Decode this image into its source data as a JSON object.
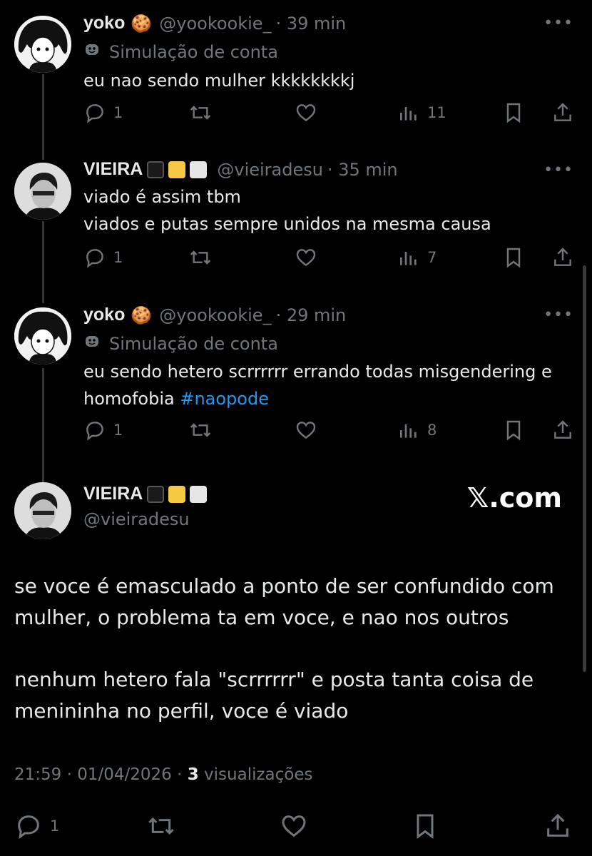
{
  "tweets": [
    {
      "name": "yoko",
      "name_emoji": "🍪",
      "handle": "@yookookie_",
      "time": "· 39 min",
      "sim_label": "Simulação de conta",
      "text": [
        "eu nao sendo mulher kkkkkkkkj"
      ],
      "replies": "1",
      "views": "11"
    },
    {
      "name": "VIEIRA",
      "handle": "@vieiradesu",
      "time": "· 35 min",
      "text": [
        "viado é assim tbm",
        "viados e putas sempre unidos na mesma causa"
      ],
      "replies": "1",
      "views": "7"
    },
    {
      "name": "yoko",
      "name_emoji": "🍪",
      "handle": "@yookookie_",
      "time": "· 29 min",
      "sim_label": "Simulação de conta",
      "text": [
        "eu sendo hetero scrrrrrr errando todas misgendering e",
        "homofobia "
      ],
      "hashtag": "#naopode",
      "replies": "1",
      "views": "8"
    }
  ],
  "main": {
    "name": "VIEIRA",
    "handle": "@vieiradesu",
    "watermark": "𝕏.com",
    "paragraph1": [
      "se voce é emasculado a ponto de ser confundido com",
      "mulher, o problema ta em voce, e nao nos outros"
    ],
    "paragraph2": [
      "nenhum hetero fala \"scrrrrrr\" e posta tanta coisa de",
      "menininha no perfil, voce é viado"
    ],
    "timestamp": "21:59 · 01/04/2026 · ",
    "views_count": "3",
    "views_label": " visualizações",
    "replies": "1"
  },
  "more_icon": "more-dots-icon",
  "colors": {
    "background": "#000000",
    "text": "#e7e9ea",
    "muted": "#71767b",
    "link": "#1d9bf0"
  }
}
